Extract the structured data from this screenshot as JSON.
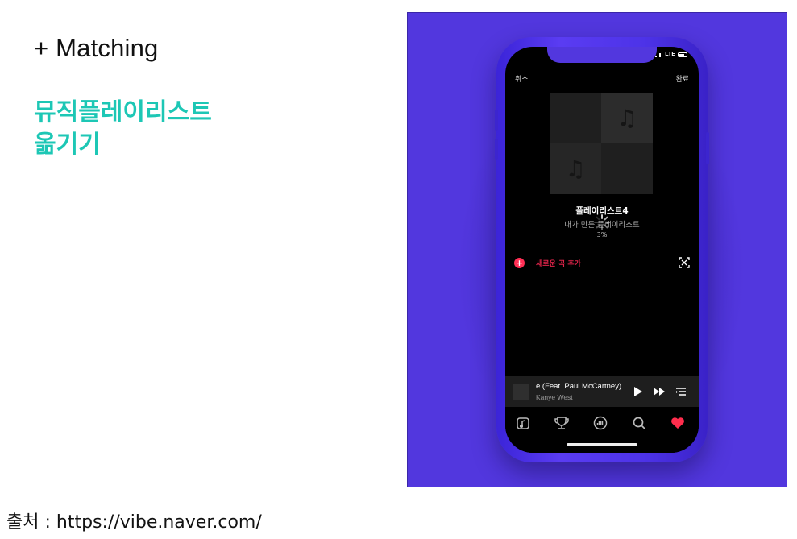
{
  "slide": {
    "heading": "+ Matching",
    "subtitle_line1": "뮤직플레이리스트",
    "subtitle_line2": "옮기기",
    "source": "출처 : https://vibe.naver.com/"
  },
  "colors": {
    "accent": "#1dc7b5",
    "promo_bg": "#5237de",
    "add_red": "#ff2f55",
    "heart_red": "#ff2d4d"
  },
  "phone": {
    "status": {
      "network": "LTE"
    },
    "header": {
      "cancel": "취소",
      "done": "완료"
    },
    "playlist": {
      "title": "플레이리스트4",
      "subtitle": "내가 만든 플레이리스트",
      "loading_caption": "3%",
      "cover_icon": "music-note-icon"
    },
    "add_song": {
      "label": "새로운 곡 추가",
      "icon": "plus-circle-icon",
      "scan_icon": "scan-icon"
    },
    "mini_player": {
      "title": "e (Feat. Paul McCartney)",
      "artist": "Kanye West",
      "buttons": [
        "play-icon",
        "fast-forward-icon",
        "queue-icon"
      ]
    },
    "tabs": [
      "home-icon",
      "trophy-icon",
      "vibe-icon",
      "search-icon",
      "heart-icon"
    ]
  }
}
